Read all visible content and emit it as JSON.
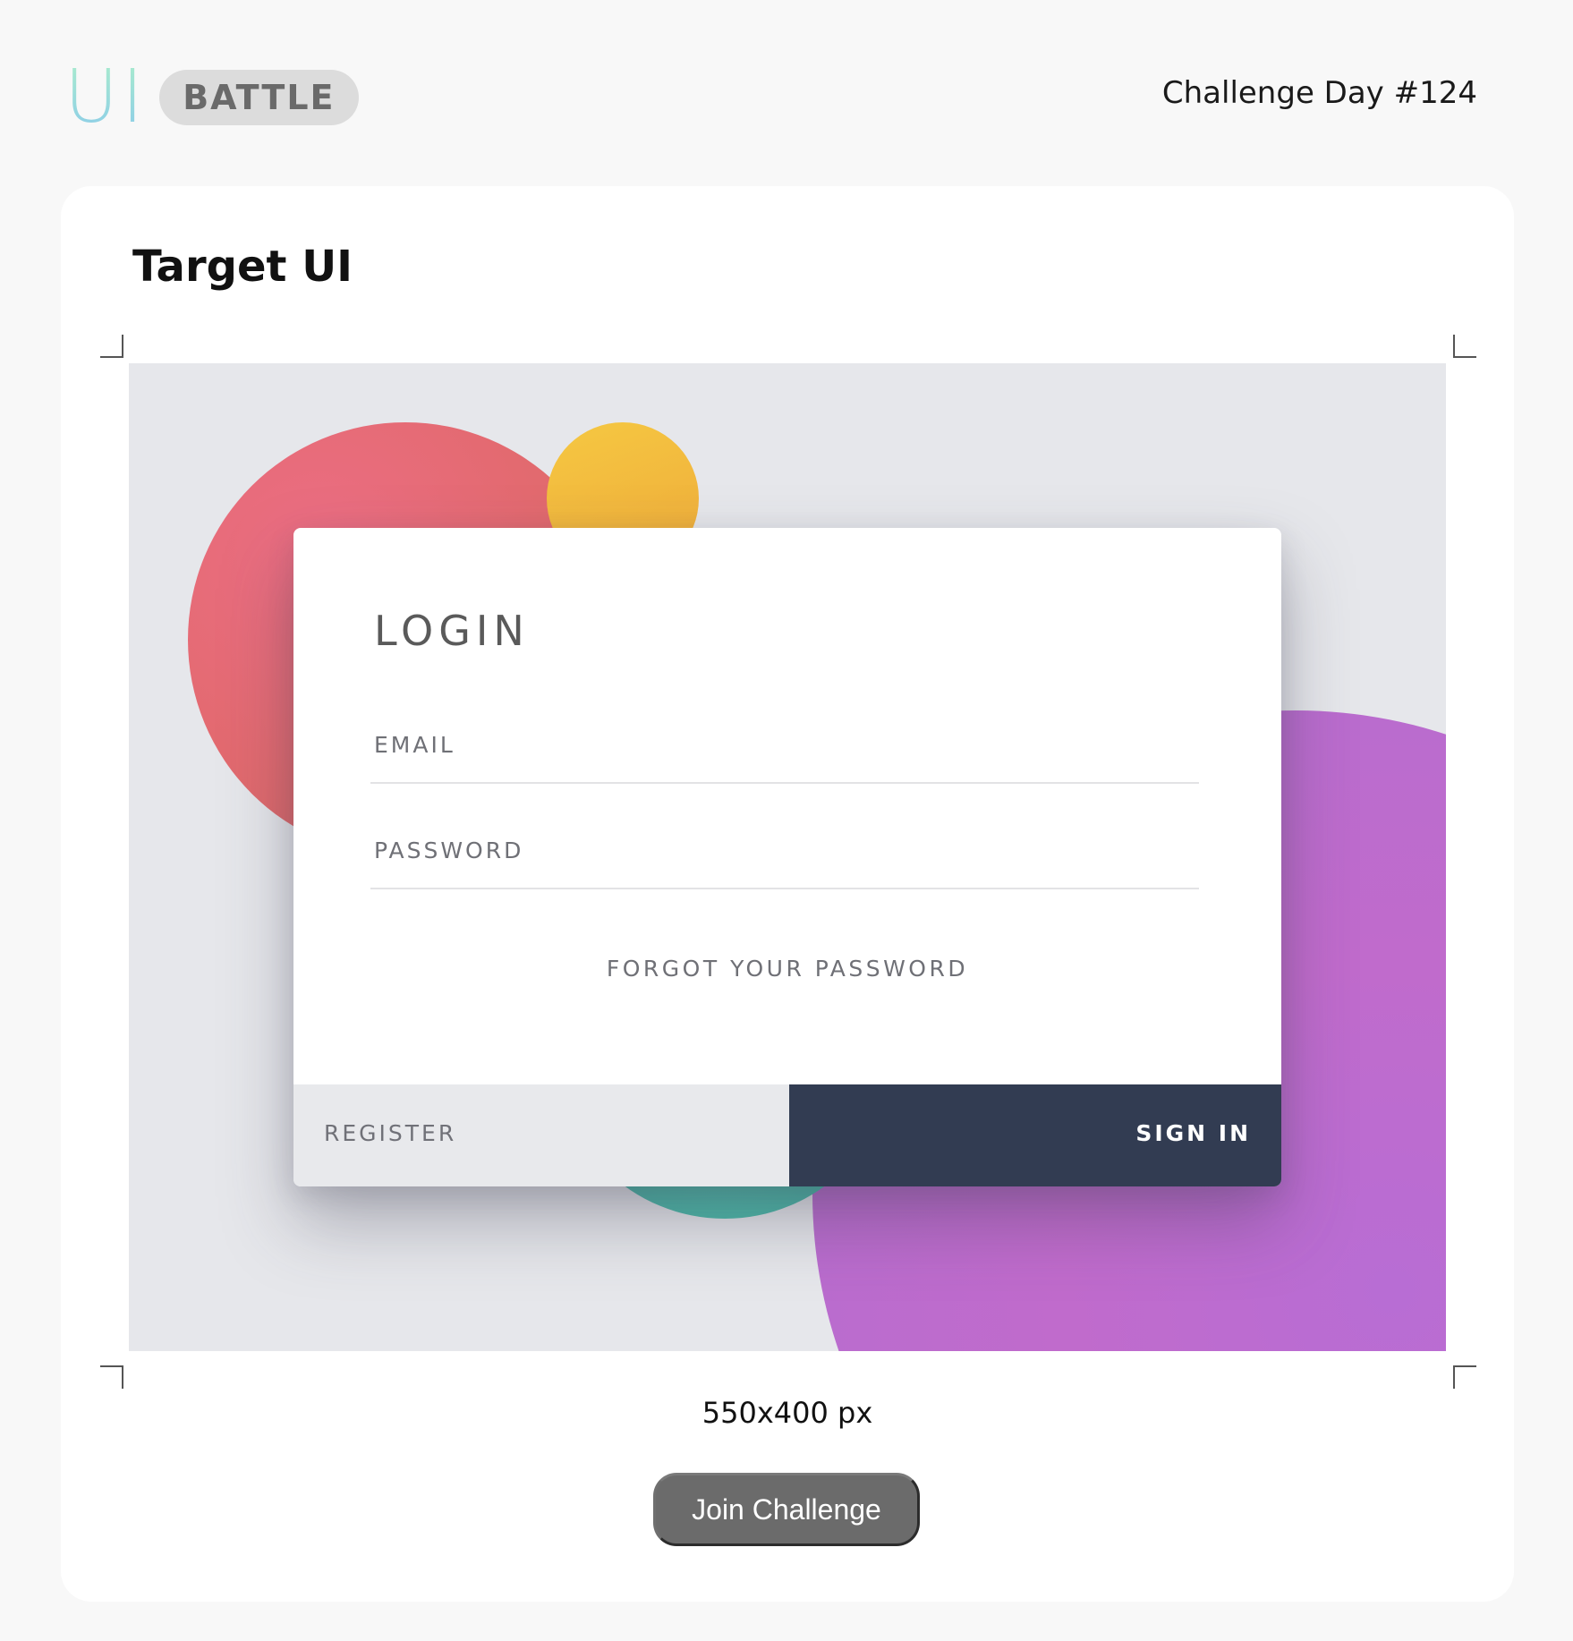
{
  "header": {
    "logo_ui": "UI",
    "logo_battle": "BATTLE",
    "challenge_day": "Challenge Day #124"
  },
  "card": {
    "title": "Target UI",
    "dimensions": "550x400 px",
    "join_button": "Join Challenge"
  },
  "login": {
    "title": "LOGIN",
    "email_label": "EMAIL",
    "password_label": "PASSWORD",
    "forgot_link": "FORGOT YOUR PASSWORD",
    "register_label": "REGISTER",
    "signin_label": "SIGN IN"
  },
  "colors": {
    "page_background": "#f8f8f8",
    "preview_background": "#e6e7eb",
    "signin_background": "#323c52",
    "register_background": "#e8e9ec",
    "blob_red": "#e36a70",
    "blob_yellow": "#f2b93e",
    "blob_teal": "#4bb8a8",
    "blob_purple": "#bb6ccf",
    "join_button_background": "#6b6b6b"
  }
}
